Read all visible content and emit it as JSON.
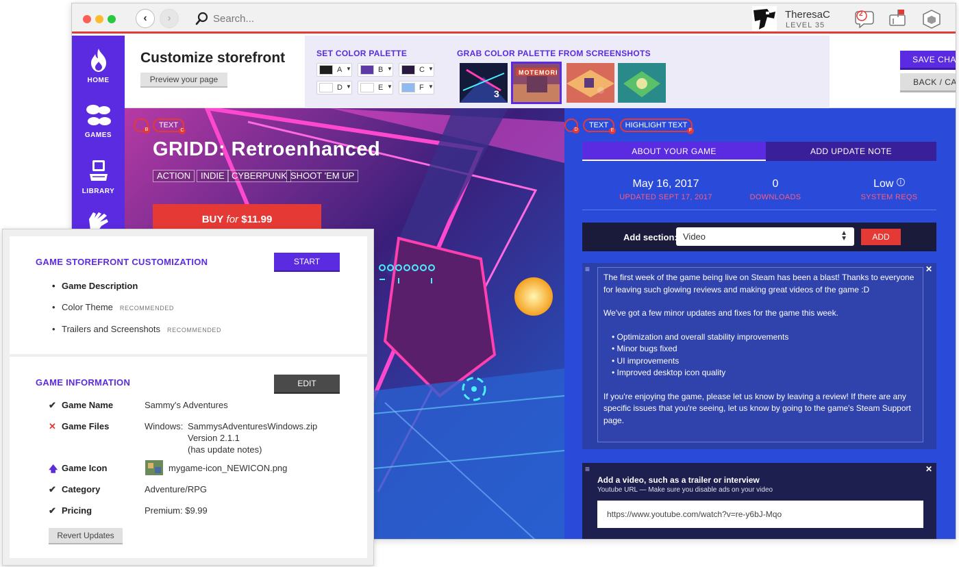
{
  "topbar": {
    "search_placeholder": "Search...",
    "username": "TheresaC",
    "level": "LEVEL 35",
    "notifications_count": "2",
    "icons": [
      "back-icon",
      "forward-icon",
      "search-icon",
      "chat-notification-icon",
      "inbox-icon",
      "cube-icon"
    ]
  },
  "sidebar": {
    "items": [
      {
        "label": "HOME",
        "icon": "flame-icon"
      },
      {
        "label": "GAMES",
        "icon": "fan-icon"
      },
      {
        "label": "LIBRARY",
        "icon": "computer-icon"
      },
      {
        "label": "",
        "icon": "hand-icon"
      }
    ]
  },
  "customize": {
    "title": "Customize storefront",
    "preview_label": "Preview your page",
    "set_palette_label": "SET COLOR PALETTE",
    "grab_palette_label": "GRAB COLOR PALETTE FROM SCREENSHOTS",
    "swatches": [
      {
        "label": "A",
        "color": "#1e1e1e"
      },
      {
        "label": "B",
        "color": "#5e3aa8"
      },
      {
        "label": "C",
        "color": "#2a1a40"
      },
      {
        "label": "D",
        "color": "#ffffff"
      },
      {
        "label": "E",
        "color": "#ffffff"
      },
      {
        "label": "F",
        "color": "#8fbaf2"
      }
    ],
    "screenshot_logo_text": "MOTEMORI",
    "save_label": "SAVE CHANGES",
    "back_label": "BACK / CANCEL"
  },
  "storefront": {
    "text_pill": "TEXT",
    "highlight_pill": "HIGHLIGHT TEXT",
    "markers": [
      "B",
      "C",
      "D",
      "E",
      "F"
    ],
    "game_title": "GRIDD: Retroenhanced",
    "tags": [
      "ACTION",
      "INDIE",
      "CYBERPUNK",
      "SHOOT 'EM UP"
    ],
    "buy_prefix": "BUY",
    "buy_for": "for",
    "buy_price": "$11.99",
    "tabs": [
      "ABOUT YOUR GAME",
      "ADD UPDATE NOTE"
    ],
    "stats": [
      {
        "value": "May 16, 2017",
        "label": "UPDATED SEPT 17, 2017"
      },
      {
        "value": "0",
        "label": "DOWNLOADS"
      },
      {
        "value": "Low",
        "label": "SYSTEM REQS"
      }
    ],
    "add_section_label": "Add section:",
    "add_section_value": "Video",
    "add_label": "ADD",
    "about_p1": "The first week of the game being live on Steam has been a blast! Thanks to everyone for leaving such glowing reviews and making great videos of the game :D",
    "about_p2": "We've got a few minor updates and fixes for the game this week.",
    "about_list": [
      "Optimization and overall stability improvements",
      "Minor bugs fixed",
      "UI improvements",
      "Improved desktop icon quality"
    ],
    "about_p3": "If you're enjoying the game, please let us know by leaving a review! If there are any specific issues that you're seeing, let us know by going to the game's Steam Support page.",
    "video_title": "Add a video, such as a trailer or interview",
    "video_help": "Youtube URL — Make sure you disable ads on your video",
    "video_url": "https://www.youtube.com/watch?v=re-y6bJ-Mqo",
    "colors": {
      "accent": "#5a2be0",
      "danger": "#e53935",
      "panel": "#2a4bd9"
    }
  },
  "overlay": {
    "customization_title": "GAME STOREFRONT CUSTOMIZATION",
    "start_label": "START",
    "steps": [
      {
        "label": "Game Description",
        "note": ""
      },
      {
        "label": "Color Theme",
        "note": "RECOMMENDED"
      },
      {
        "label": "Trailers and Screenshots",
        "note": "RECOMMENDED"
      }
    ],
    "info_title": "GAME INFORMATION",
    "edit_label": "EDIT",
    "info_rows": [
      {
        "status": "check",
        "key": "Game Name",
        "value": "Sammy's Adventures"
      },
      {
        "status": "error",
        "key": "Game Files",
        "value": "Windows:",
        "value2": "SammysAdventuresWindows.zip",
        "value3": "Version 2.1.1",
        "value4": "(has update notes)"
      },
      {
        "status": "upload",
        "key": "Game Icon",
        "value": "mygame-icon_NEWICON.png"
      },
      {
        "status": "check",
        "key": "Category",
        "value": "Adventure/RPG"
      },
      {
        "status": "check",
        "key": "Pricing",
        "value": "Premium: $9.99"
      }
    ],
    "revert_label": "Revert Updates"
  }
}
